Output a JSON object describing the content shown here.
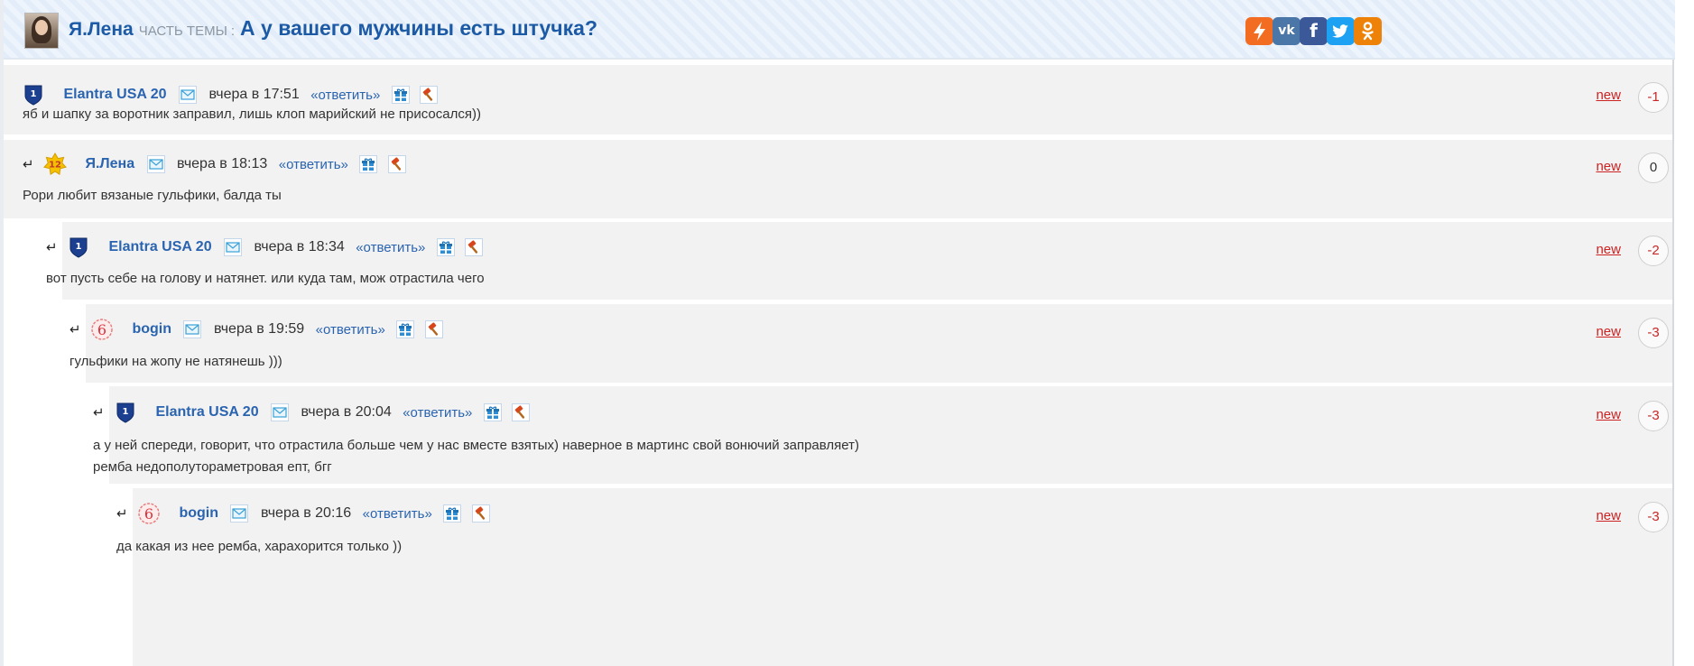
{
  "header": {
    "author": "Я.Лена",
    "part_label": "часть темы",
    "separator": ":",
    "topic_title": "А у вашего мужчины есть штучка?",
    "share": [
      {
        "icon": "lightning-icon",
        "glyph": "⚡",
        "color": "#f26d21"
      },
      {
        "icon": "vk-icon",
        "glyph": "vk",
        "color": "#4a76a8"
      },
      {
        "icon": "facebook-icon",
        "glyph": "f",
        "color": "#3b5998"
      },
      {
        "icon": "twitter-icon",
        "glyph": "🐦",
        "color": "#1da1f2"
      },
      {
        "icon": "odnoklassniki-icon",
        "glyph": "ок",
        "color": "#ee8208"
      }
    ]
  },
  "comments": [
    {
      "author": "Elantra USA 20",
      "badge": "1",
      "badge_type": "shield",
      "time": "вчера в 17:51",
      "reply": "«ответить»",
      "text": [
        "яб и шапку за воротник заправил, лишь клоп марийский не присосался))"
      ],
      "new_label": "new",
      "score": "-1"
    },
    {
      "author": "Я.Лена",
      "badge": "12",
      "badge_type": "star",
      "time": "вчера в 18:13",
      "reply": "«ответить»",
      "text": [
        "Рори любит вязаные гульфики, балда ты"
      ],
      "new_label": "new",
      "score": "0"
    },
    {
      "author": "Elantra USA 20",
      "badge": "1",
      "badge_type": "shield",
      "time": "вчера в 18:34",
      "reply": "«ответить»",
      "text": [
        "вот пусть себе на голову и натянет. или куда там, мож отрастила чего"
      ],
      "new_label": "new",
      "score": "-2"
    },
    {
      "author": "bogin",
      "badge": "6",
      "badge_type": "seal",
      "time": "вчера в 19:59",
      "reply": "«ответить»",
      "text": [
        "гульфики на жопу не натянешь )))"
      ],
      "new_label": "new",
      "score": "-3"
    },
    {
      "author": "Elantra USA 20",
      "badge": "1",
      "badge_type": "shield",
      "time": "вчера в 20:04",
      "reply": "«ответить»",
      "text": [
        "а у ней спереди, говорит, что отрастила больше чем у нас вместе взятых) наверное в мартинс свой вонючий заправляет)",
        "ремба недополутораметровая епт, бгг"
      ],
      "new_label": "new",
      "score": "-3"
    },
    {
      "author": "bogin",
      "badge": "6",
      "badge_type": "seal",
      "time": "вчера в 20:16",
      "reply": "«ответить»",
      "text": [
        "да какая из нее ремба, харахорится только ))"
      ],
      "new_label": "new",
      "score": "-3"
    }
  ],
  "reply_arrow": "↵",
  "colors": {
    "link": "#2a64b0",
    "new": "#cc2222",
    "score_negative": "#c62828",
    "card_bg": "#f2f2f2"
  }
}
